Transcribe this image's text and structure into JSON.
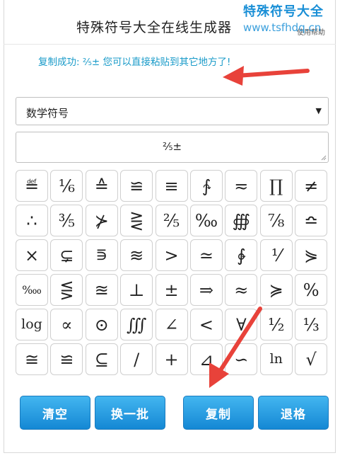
{
  "header": {
    "title": "特殊符号大全在线生成器",
    "help": "使用帮助"
  },
  "watermark": {
    "line1": "特殊符号大全",
    "line2": "www.tsfhdq.cn"
  },
  "status": {
    "message": "复制成功: ⅖± 您可以直接粘贴到其它地方了!"
  },
  "category": {
    "selected": "数学符号",
    "caret": "▼"
  },
  "output": {
    "value": "⅖±"
  },
  "symbols": [
    "≝",
    "⅙",
    "≙",
    "≌",
    "≡",
    "∱",
    "≂",
    "∏",
    "≠",
    "∴",
    "⅗",
    "⊁",
    "⋛",
    "⅖",
    "‰",
    "∰",
    "⅞",
    "≏",
    "×",
    "⊊",
    "⋾",
    "≋",
    ">",
    "≃",
    "∲",
    "⅟",
    "⋟",
    "‱",
    "⋚",
    "≊",
    "⊥",
    "±",
    "⇒",
    "≈",
    "≽",
    "%",
    "log",
    "∝",
    "⊙",
    "∭",
    "∠",
    "<",
    "∀",
    "½",
    "⅓",
    "≅",
    "≌",
    "⊆",
    "∕",
    "+",
    "⊿",
    "∽",
    "ln",
    "√"
  ],
  "buttons": {
    "clear": "清空",
    "refresh": "换一批",
    "copy": "复制",
    "backspace": "退格"
  },
  "colors": {
    "button_top": "#43b6f0",
    "button_bottom": "#1488d4",
    "message": "#1a9bc9",
    "watermark": "#1a8fd6",
    "arrow": "#e8423a"
  }
}
